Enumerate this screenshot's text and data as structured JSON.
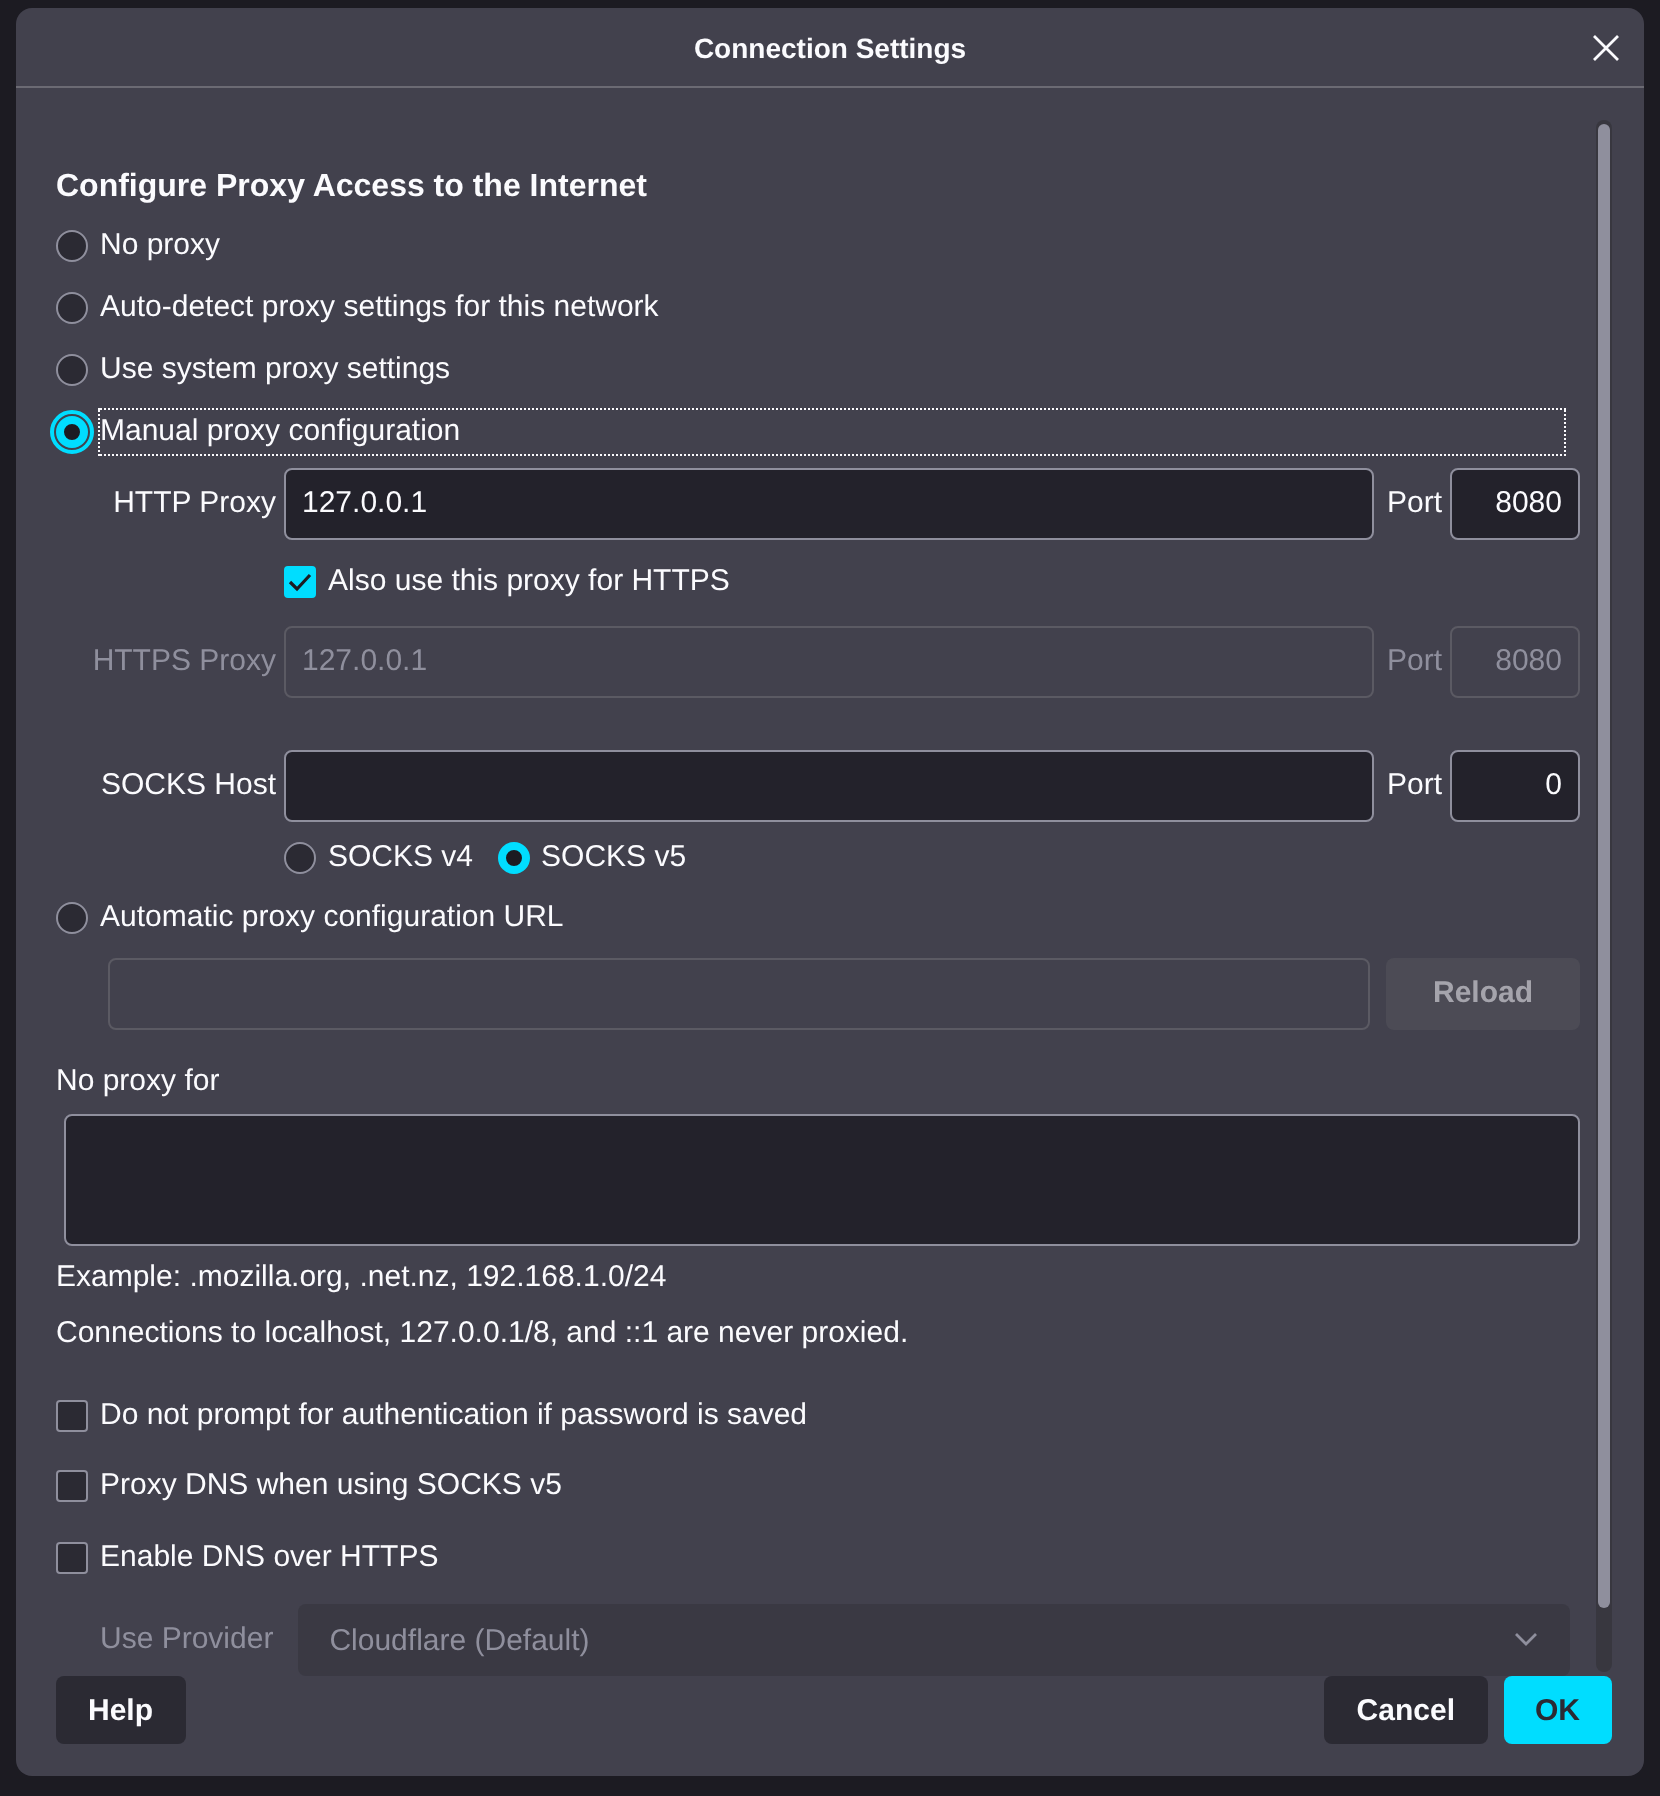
{
  "dialog": {
    "title": "Connection Settings"
  },
  "heading": "Configure Proxy Access to the Internet",
  "proxy_modes": [
    {
      "label": "No proxy",
      "selected": false,
      "focused": false
    },
    {
      "label": "Auto-detect proxy settings for this network",
      "selected": false,
      "focused": false
    },
    {
      "label": "Use system proxy settings",
      "selected": false,
      "focused": false
    },
    {
      "label": "Manual proxy configuration",
      "selected": true,
      "focused": true
    }
  ],
  "proxy_fields": [
    {
      "kind": "field",
      "label": "HTTP Proxy",
      "value": "127.0.0.1",
      "port_label": "Port",
      "port": "8080",
      "disabled": false
    },
    {
      "kind": "checkbox",
      "label": "Also use this proxy for HTTPS",
      "checked": true
    },
    {
      "kind": "field",
      "label": "HTTPS Proxy",
      "value": "127.0.0.1",
      "port_label": "Port",
      "port": "8080",
      "disabled": true
    },
    {
      "kind": "field",
      "label": "SOCKS Host",
      "port_label": "Port",
      "port": "0",
      "disabled": false
    }
  ],
  "socks_versions": [
    {
      "label": "SOCKS v4",
      "selected": false
    },
    {
      "label": "SOCKS v5",
      "selected": true
    }
  ],
  "auto_config": {
    "label": "Automatic proxy configuration URL",
    "selected": false,
    "focused": false,
    "reload": {
      "label": "Reload",
      "disabled": true
    }
  },
  "no_proxy_for": {
    "label": "No proxy for"
  },
  "hints": [
    "Example: .mozilla.org, .net.nz, 192.168.1.0/24",
    "Connections to localhost, 127.0.0.1/8, and ::1 are never proxied."
  ],
  "options": [
    {
      "label": "Do not prompt for authentication if password is saved",
      "checked": false
    },
    {
      "label": "Proxy DNS when using SOCKS v5",
      "checked": false
    },
    {
      "label": "Enable DNS over HTTPS",
      "checked": false
    }
  ],
  "provider": {
    "label": "Use Provider",
    "value": "Cloudflare (Default)"
  },
  "buttons": {
    "help": "Help",
    "cancel": "Cancel",
    "ok": "OK"
  }
}
